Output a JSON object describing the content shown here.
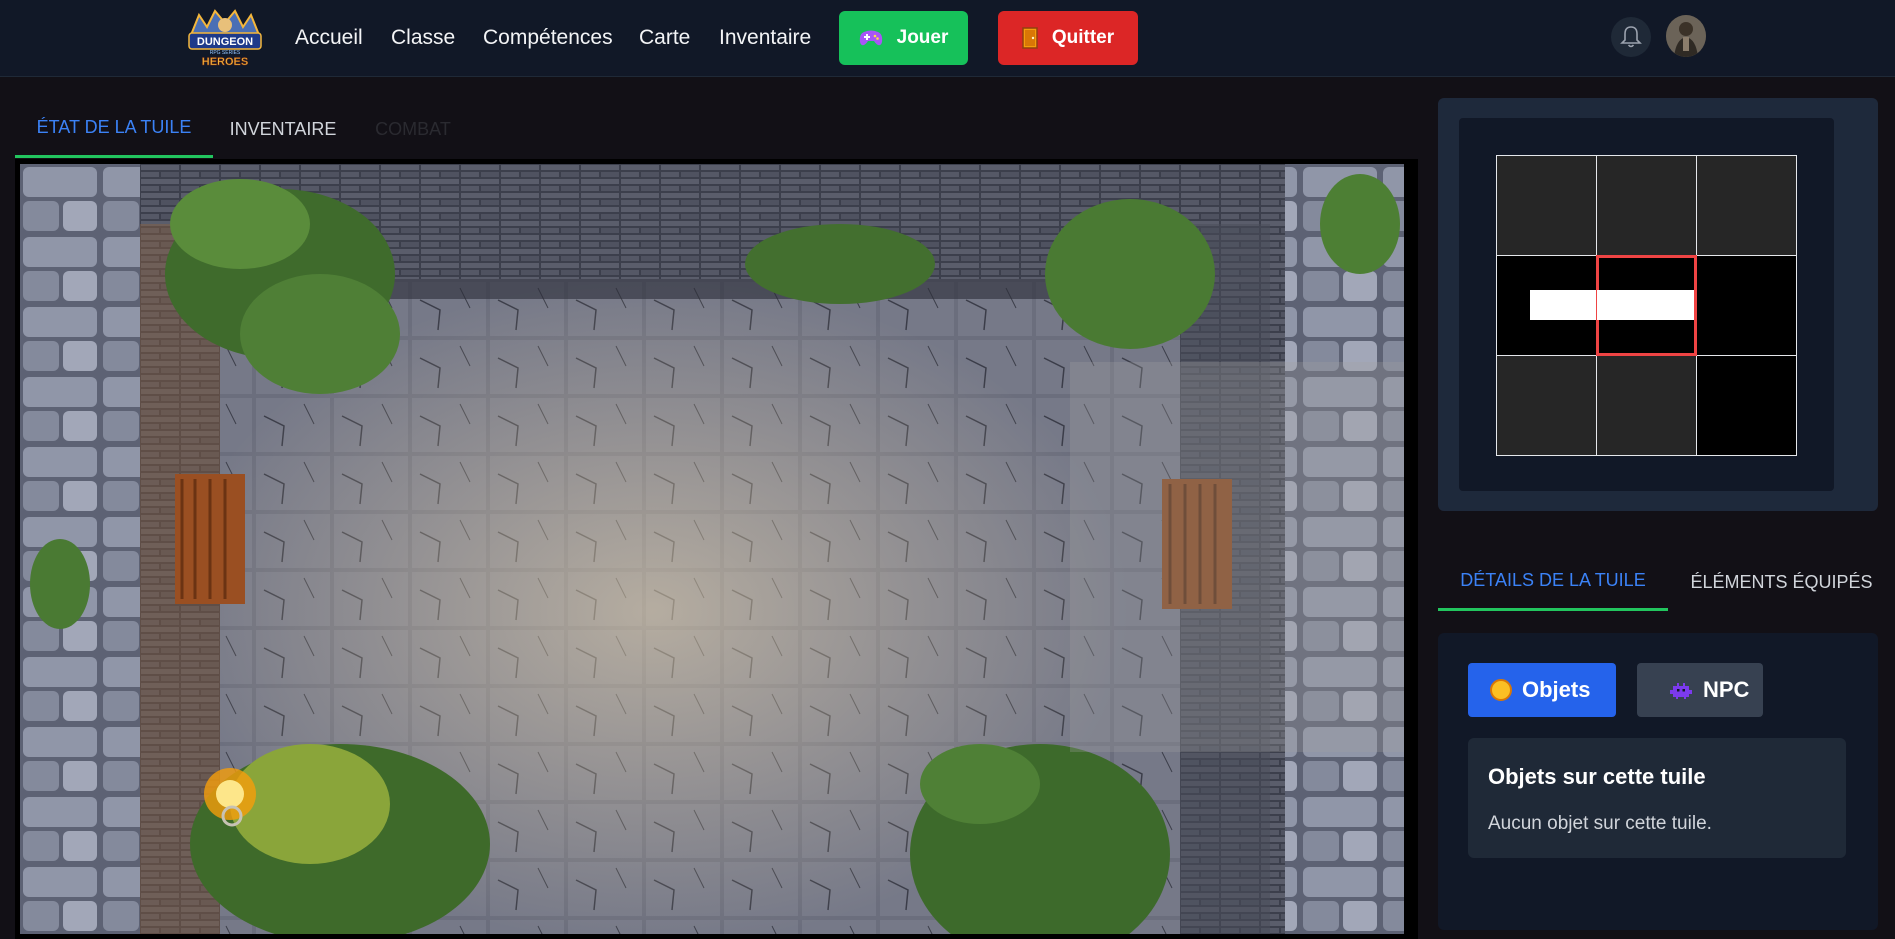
{
  "nav": {
    "logo_top": "DUNGEON",
    "logo_mid": "RPG SERIES",
    "logo_bottom": "HEROES",
    "links": [
      "Accueil",
      "Classe",
      "Compétences",
      "Carte",
      "Inventaire"
    ],
    "play_label": "Jouer",
    "quit_label": "Quitter",
    "play_icon": "gamepad-icon",
    "quit_icon": "door-icon",
    "bell_icon": "bell-icon"
  },
  "left_tabs": [
    "ÉTAT DE LA TUILE",
    "INVENTAIRE",
    "COMBAT"
  ],
  "minimap": {
    "cells": [
      {
        "row": 0,
        "col": 0,
        "fill": "dark"
      },
      {
        "row": 0,
        "col": 1,
        "fill": "dark"
      },
      {
        "row": 0,
        "col": 2,
        "fill": "dark"
      },
      {
        "row": 1,
        "col": 0,
        "fill": "black",
        "path": "east"
      },
      {
        "row": 1,
        "col": 1,
        "fill": "black",
        "path": "west",
        "current": true
      },
      {
        "row": 1,
        "col": 2,
        "fill": "black"
      },
      {
        "row": 2,
        "col": 0,
        "fill": "dark"
      },
      {
        "row": 2,
        "col": 1,
        "fill": "dark"
      },
      {
        "row": 2,
        "col": 2,
        "fill": "black"
      }
    ]
  },
  "right_tabs": [
    "DÉTAILS DE LA TUILE",
    "ÉLÉMENTS ÉQUIPÉS"
  ],
  "details": {
    "objets_label": "Objets",
    "npc_label": "NPC",
    "objects_title": "Objets sur cette tuile",
    "objects_empty": "Aucun objet sur cette tuile."
  },
  "colors": {
    "accent_blue": "#3b82f6",
    "tab_underline": "#22c55e",
    "play": "#16c15a",
    "quit": "#dc2626",
    "current_cell_border": "#ef4444"
  }
}
